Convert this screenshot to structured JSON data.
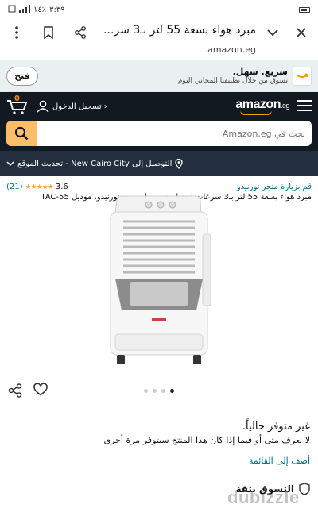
{
  "status_bar": {
    "time": "٣:٣٩",
    "battery": "٪١٤"
  },
  "browser": {
    "page_title": "مبرد هواء بسعة 55 لتر بـ3 سر...",
    "url": "amazon.eg"
  },
  "promo": {
    "open_label": "فتح",
    "title": "سريع. سهل.",
    "subtitle": "تسوق من خلال تطبيقنا المجاني اليوم"
  },
  "header": {
    "logo_text": "amazon",
    "logo_suffix": ".eg",
    "cart_count": "0",
    "sign_in": "تسجيل الدخول ›"
  },
  "search": {
    "placeholder": "بحث في Amazon.eg"
  },
  "location": {
    "text": "التوصيل إلى New Cairo City - تحديث الموقع"
  },
  "product": {
    "store_link": "قم بزيارة متجر تورنيدو",
    "rating_value": "3.6",
    "stars": "★★★★★",
    "rating_count": "(21)",
    "title": "مبرد هواء بسعة 55 لتر بـ3 سرعات لون ابيض ورمادي من تورنيدو، موديل TAC-55"
  },
  "availability": {
    "status": "غير متوفر حالياً.",
    "note": "لا نعرف متى أو فيما إذا كان هذا المنتج سيتوفر مرة أخرى",
    "add_to_list": "أضف إلى القائمة"
  },
  "secure": {
    "label": "التسوق بثقة"
  },
  "watermark": {
    "text": "dubizzle"
  },
  "carousel": {
    "active_index": 3,
    "count": 4
  },
  "colors": {
    "header_bg": "#131921",
    "location_bg": "#232f3e",
    "search_button": "#febd69",
    "link": "#007185",
    "star": "#f3a847"
  }
}
